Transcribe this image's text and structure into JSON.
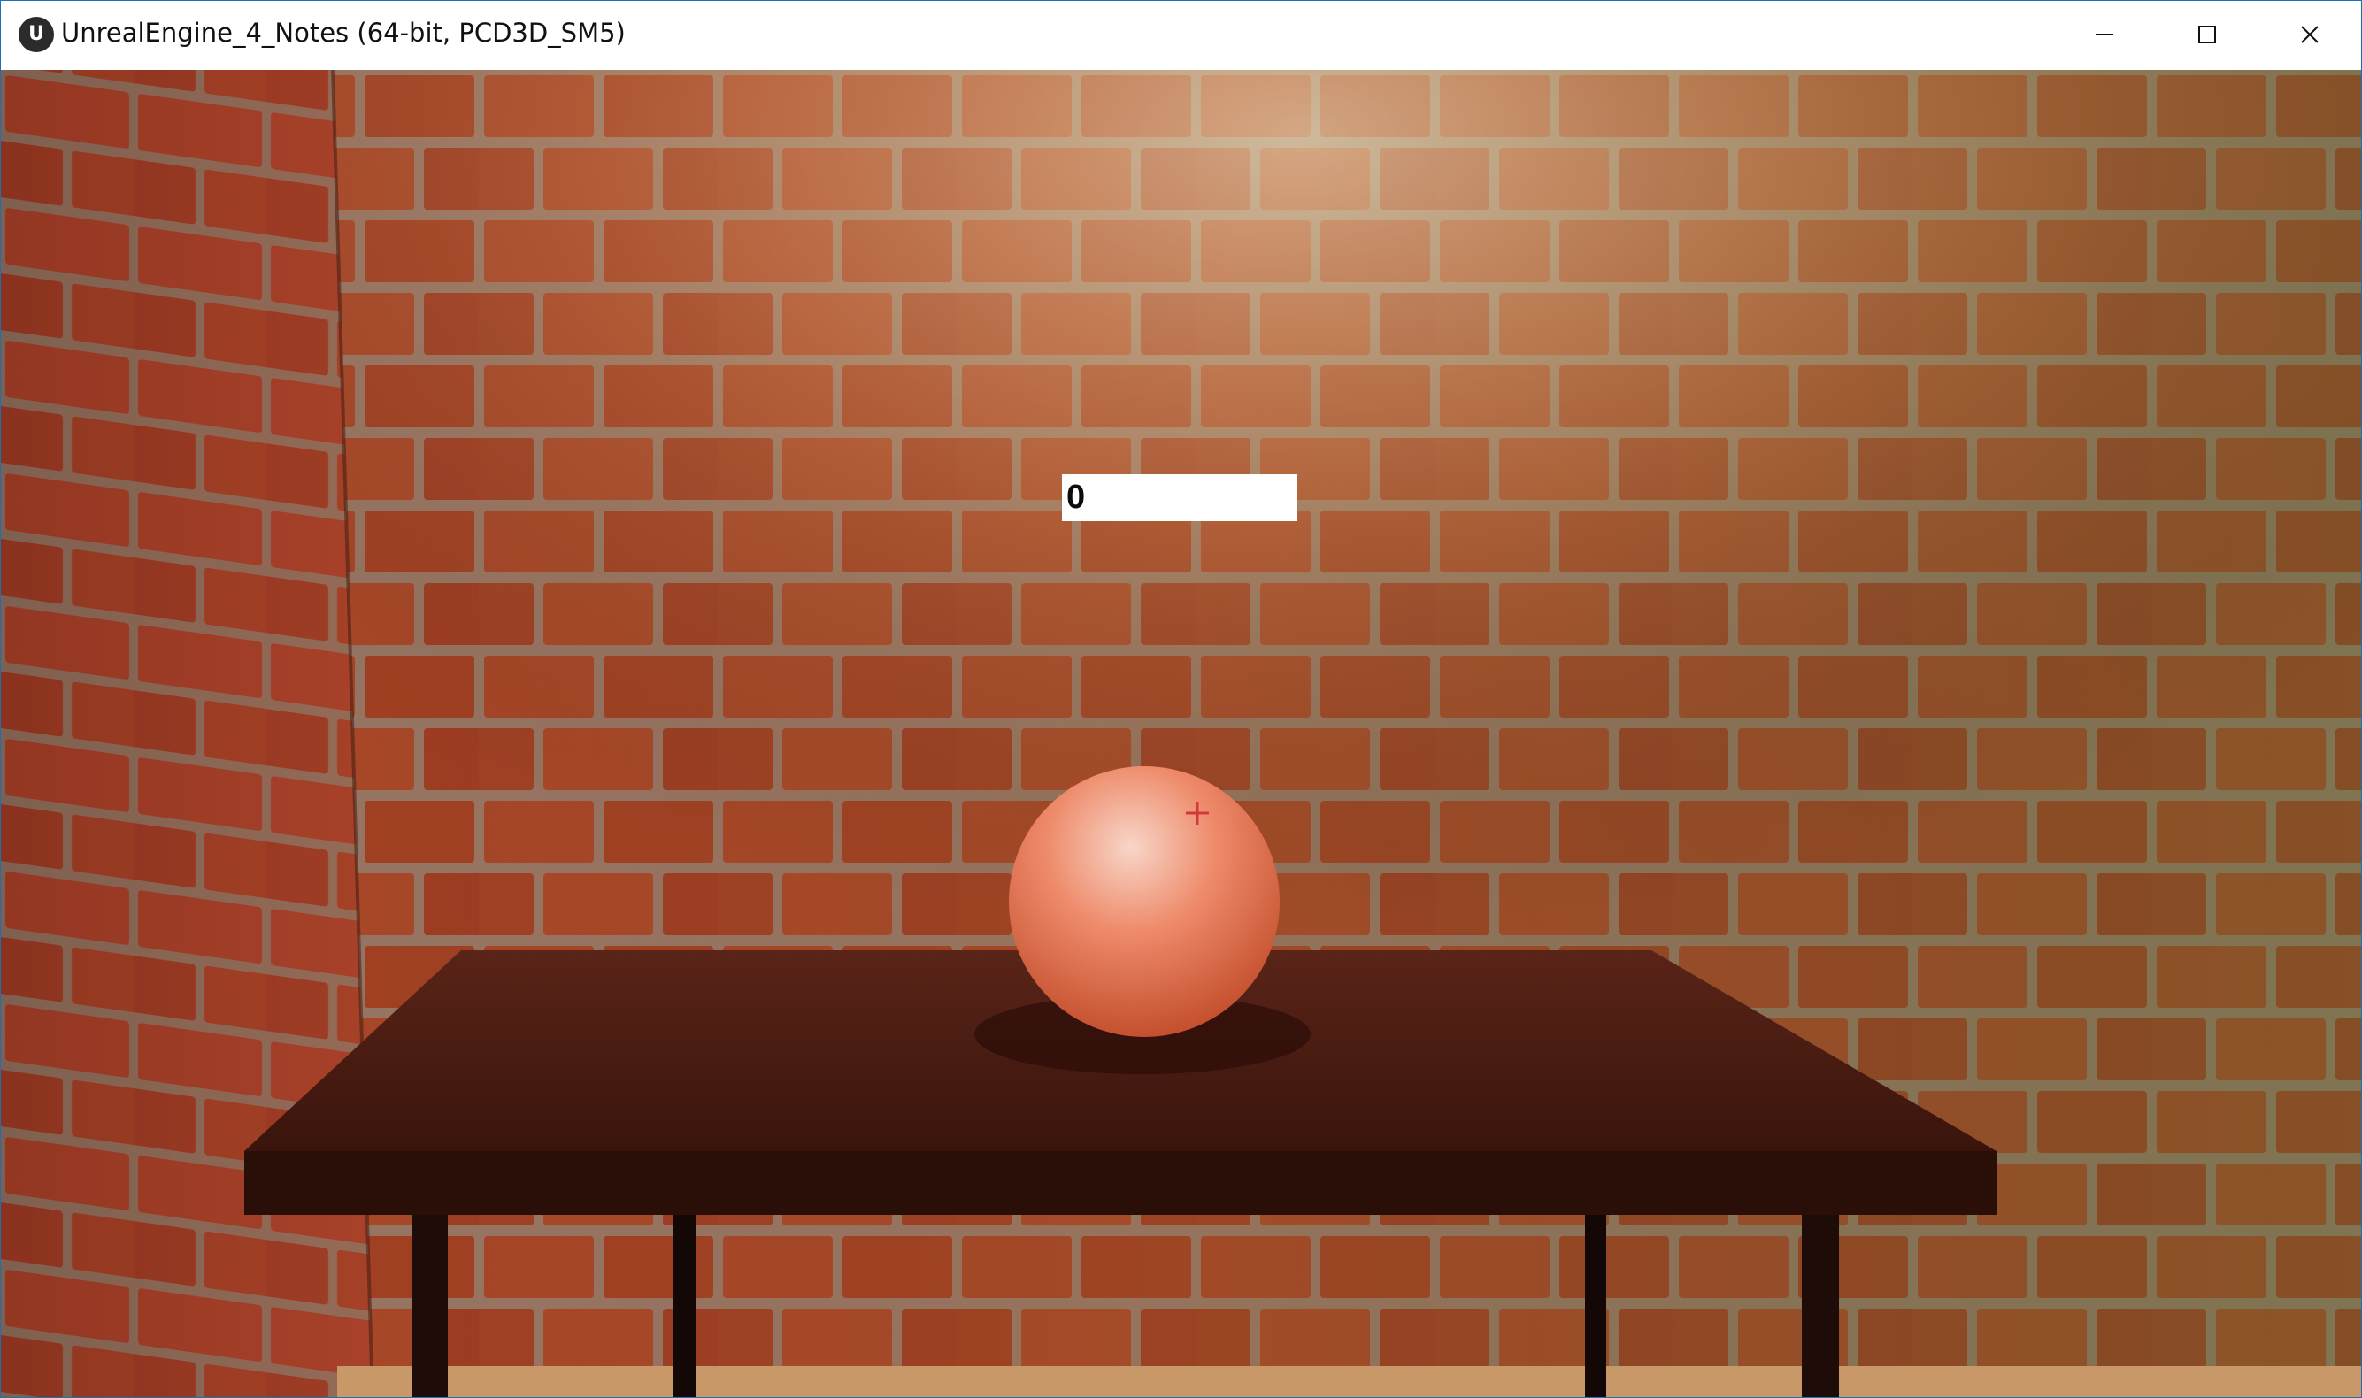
{
  "window": {
    "title": "UnrealEngine_4_Notes (64-bit, PCD3D_SM5)",
    "app_icon_glyph": "U",
    "icon_name": "unreal-engine-icon",
    "controls": [
      {
        "name": "minimize-icon"
      },
      {
        "name": "maximize-icon"
      },
      {
        "name": "close-icon"
      }
    ]
  },
  "hud": {
    "score": "0"
  },
  "scene": {
    "wall_color": "#b54a2a",
    "mortar_color": "#9a8a7a",
    "table_color": "#3a1a12",
    "ball_color": "#e8755a",
    "crosshair_color": "#d23a3a"
  }
}
